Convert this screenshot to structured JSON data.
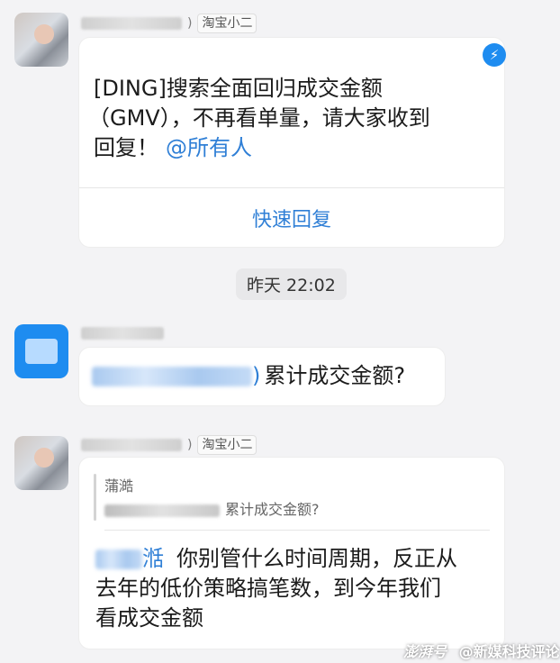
{
  "message1": {
    "sender_tag": "淘宝小二",
    "name_suffix": ")",
    "badge_icon": "lightning-icon",
    "text_line1": "[DING]搜索全面回归成交金额",
    "text_line2": "（GMV），不再看单量，请大家收到",
    "text_line3_prefix": "回复！",
    "mention": "@所有人",
    "quick_reply_label": "快速回复"
  },
  "timestamp": "昨天 22:02",
  "message2": {
    "mention_suffix": ")",
    "text": "累计成交金额?"
  },
  "message3": {
    "sender_tag": "淘宝小二",
    "name_suffix": ")",
    "quote_name": "蒲澔",
    "quote_text": "累计成交金额?",
    "mention_name": "湉",
    "line1": "你别管什么时间周期，反正从",
    "line2": "去年的低价策略搞笔数，到今年我们",
    "line3": "看成交金额"
  },
  "watermark": {
    "left": "澎湃号",
    "right": "@新媒科技评论"
  },
  "colors": {
    "accent_blue": "#1e8cf0",
    "mention_blue": "#2f7fd6",
    "background": "#f3f3f5"
  }
}
